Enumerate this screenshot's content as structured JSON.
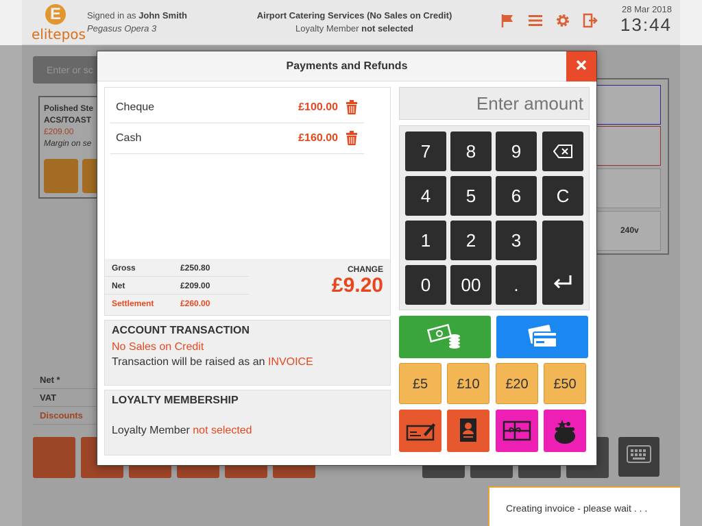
{
  "header": {
    "logo_text": "elitepos",
    "signed_in_prefix": "Signed in as",
    "user_name": "John Smith",
    "terminal": "Pegasus Opera 3",
    "customer": "Airport Catering Services (No Sales on Credit)",
    "loyalty_prefix": "Loyalty Member",
    "loyalty_status": "not selected",
    "date": "28 Mar 2018",
    "time": "13:44"
  },
  "background": {
    "search_placeholder": "Enter or sc",
    "product": {
      "name": "Polished Ste ACS/TOAST",
      "price": "£209.00",
      "margin": "Margin on se"
    },
    "summary": [
      {
        "label": "Net *"
      },
      {
        "label": "VAT"
      },
      {
        "label": "Discounts"
      }
    ],
    "right_panel_text": "240v"
  },
  "modal": {
    "title": "Payments and Refunds",
    "payments": [
      {
        "name": "Cheque",
        "amount": "£100.00"
      },
      {
        "name": "Cash",
        "amount": "£160.00"
      }
    ],
    "totals": {
      "gross_label": "Gross",
      "gross": "£250.80",
      "net_label": "Net",
      "net": "£209.00",
      "settlement_label": "Settlement",
      "settlement": "£260.00"
    },
    "change_label": "CHANGE",
    "change_value": "£9.20",
    "account": {
      "title": "ACCOUNT TRANSACTION",
      "status": "No Sales on Credit",
      "line_prefix": "Transaction will be raised as an",
      "line_type": "INVOICE"
    },
    "loyalty": {
      "title": "LOYALTY MEMBERSHIP",
      "prefix": "Loyalty Member",
      "status": "not selected"
    },
    "amount_placeholder": "Enter amount",
    "keys": [
      "7",
      "8",
      "9",
      "4",
      "5",
      "6",
      "C",
      "1",
      "2",
      "3",
      "0",
      "00",
      "."
    ],
    "quick_amounts": [
      "£5",
      "£10",
      "£20",
      "£50"
    ]
  },
  "toast": "Creating invoice - please wait . . .",
  "colors": {
    "accent": "#e8471e",
    "cash": "#3aa53a",
    "card": "#1a88f0",
    "quick": "#f3b655",
    "magenta": "#ee1fb4"
  }
}
